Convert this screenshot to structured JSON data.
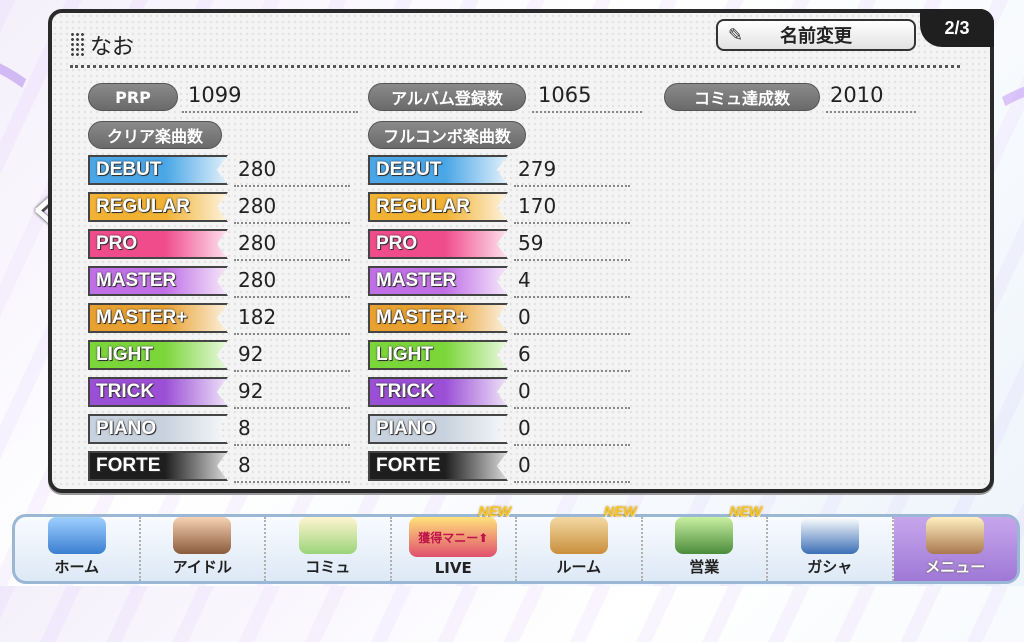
{
  "header": {
    "name": "なお",
    "rename_label": "名前変更",
    "page": "2/3"
  },
  "stats": [
    {
      "label": "PRP",
      "value": "1099"
    },
    {
      "label": "アルバム登録数",
      "value": "1065"
    },
    {
      "label": "コミュ達成数",
      "value": "2010"
    }
  ],
  "clear_header": "クリア楽曲数",
  "fullcombo_header": "フルコンボ楽曲数",
  "difficulties": [
    {
      "name": "DEBUT",
      "color": "#4aa6e6",
      "clear": "280",
      "fullcombo": "279"
    },
    {
      "name": "REGULAR",
      "color": "#f2b233",
      "clear": "280",
      "fullcombo": "170"
    },
    {
      "name": "PRO",
      "color": "#f04c8c",
      "clear": "280",
      "fullcombo": "59"
    },
    {
      "name": "MASTER",
      "color": "#c070e6",
      "clear": "280",
      "fullcombo": "4"
    },
    {
      "name": "MASTER+",
      "color": "#e8a030",
      "clear": "182",
      "fullcombo": "0"
    },
    {
      "name": "LIGHT",
      "color": "#7bd63a",
      "clear": "92",
      "fullcombo": "6"
    },
    {
      "name": "TRICK",
      "color": "#9b4fd6",
      "clear": "92",
      "fullcombo": "0"
    },
    {
      "name": "PIANO",
      "color": "#c8d2de",
      "clear": "8",
      "fullcombo": "0"
    },
    {
      "name": "FORTE",
      "color": "#1e1e1e",
      "clear": "8",
      "fullcombo": "0"
    }
  ],
  "nav": [
    {
      "label": "ホーム",
      "icon": "castle-icon",
      "new": ""
    },
    {
      "label": "アイドル",
      "icon": "idol-icon",
      "new": ""
    },
    {
      "label": "コミュ",
      "icon": "chat-icon",
      "new": ""
    },
    {
      "label": "LIVE",
      "icon": "live-icon",
      "new": "NEW",
      "sub": "獲得マニー⬆"
    },
    {
      "label": "ルーム",
      "icon": "room-icon",
      "new": "NEW"
    },
    {
      "label": "営業",
      "icon": "map-icon",
      "new": "NEW"
    },
    {
      "label": "ガシャ",
      "icon": "gacha-icon",
      "new": ""
    },
    {
      "label": "メニュー",
      "icon": "menu-icon",
      "new": ""
    }
  ]
}
